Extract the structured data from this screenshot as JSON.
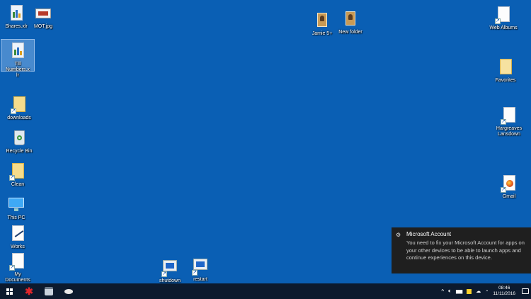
{
  "desktop_icons": [
    {
      "label": "Shares.xlr",
      "icon": "spreadsheet-icon"
    },
    {
      "label": "MOT.jpg",
      "icon": "image-icon"
    },
    {
      "label": "Till Numbers.xlr",
      "icon": "spreadsheet-icon"
    },
    {
      "label": "downloads",
      "icon": "folder-icon"
    },
    {
      "label": "Recycle Bin",
      "icon": "recycle-bin-icon"
    },
    {
      "label": "Clean",
      "icon": "folder-icon"
    },
    {
      "label": "This PC",
      "icon": "computer-icon"
    },
    {
      "label": "Works",
      "icon": "document-icon"
    },
    {
      "label": "My Documents",
      "icon": "document-icon"
    },
    {
      "label": "Jamie 5+",
      "icon": "photo-icon"
    },
    {
      "label": "New folder",
      "icon": "photo-icon"
    },
    {
      "label": "shutdown",
      "icon": "shortcut-icon"
    },
    {
      "label": "restart",
      "icon": "shortcut-icon"
    },
    {
      "label": "Web Albums",
      "icon": "document-icon"
    },
    {
      "label": "Favorites",
      "icon": "folder-icon"
    },
    {
      "label": "Hargreaves Lansdown",
      "icon": "document-icon"
    },
    {
      "label": "Gmail",
      "icon": "firefox-icon"
    }
  ],
  "notification": {
    "title": "Microsoft Account",
    "body": "You need to fix your Microsoft Account for apps on your other devices to be able to launch apps and continue experiences on this device."
  },
  "taskbar": {
    "clock_time": "08:46",
    "clock_date": "11/11/2016",
    "tray_overflow": "^",
    "pinned": [
      "app-red-icon",
      "printer-icon",
      "disc-icon"
    ]
  }
}
